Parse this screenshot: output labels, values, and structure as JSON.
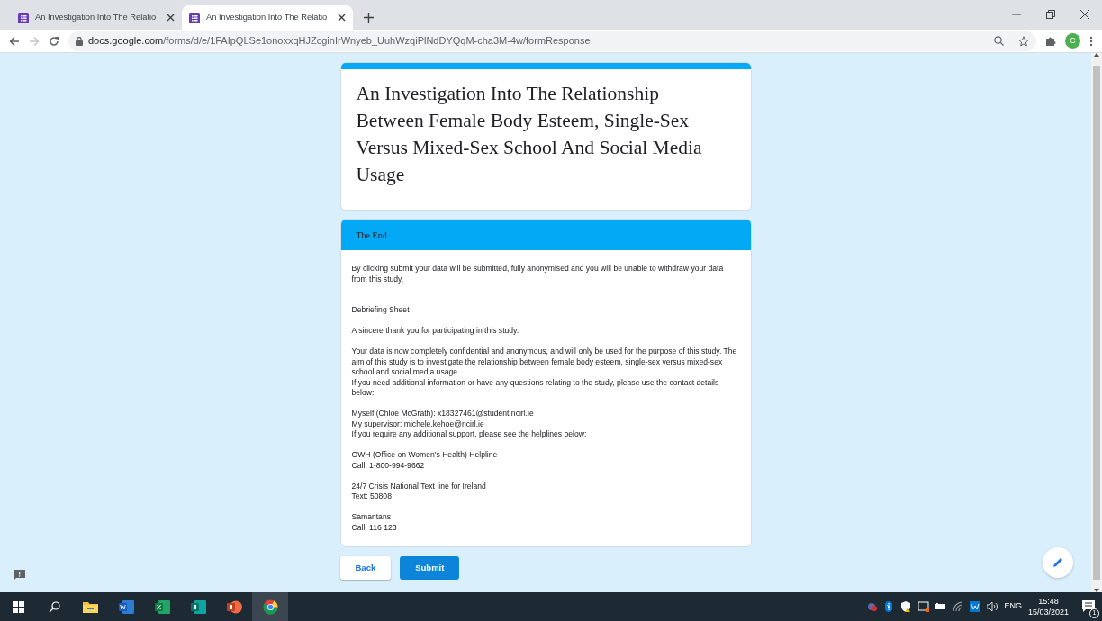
{
  "browser": {
    "tabs": [
      {
        "title": "An Investigation Into The Relatio",
        "selected": false
      },
      {
        "title": "An Investigation Into The Relatio",
        "selected": true
      }
    ],
    "url": {
      "domain": "docs.google.com",
      "path": "/forms/d/e/1FAIpQLSe1onoxxqHJZcginIrWnyeb_UuhWzqiPlNdDYQqM-cha3M-4w/formResponse"
    },
    "forward_disabled": true,
    "profile_initial": "C"
  },
  "form": {
    "title": "An Investigation Into The Relationship Between Female Body Esteem, Single-Sex Versus Mixed-Sex School And Social Media Usage",
    "section_title": "The End",
    "blocks": [
      {
        "lines": [
          {
            "text": "By clicking submit your data will be submitted, fully anonymised and you will be unable to withdraw your data from this study."
          }
        ]
      },
      {
        "lines": [
          {
            "text": "Debriefing Sheet"
          }
        ]
      },
      {
        "lines": [
          {
            "text": "A sincere thank you for participating in this study."
          }
        ]
      },
      {
        "lines": [
          {
            "text": "Your data is now completely confidential and anonymous, and will only be used for the purpose of this study. The aim of this study is to investigate the relationship between female body esteem, single-sex versus mixed-sex school and social media usage."
          },
          {
            "text": "If you need additional information or have any questions relating to the study, please use the contact details below:"
          }
        ]
      },
      {
        "lines": [
          {
            "text": "Myself (Chloe McGrath): ",
            "link": "x18327461@student.ncirl.ie"
          },
          {
            "text": "My supervisor: ",
            "link": "michele.kehoe@ncirl.ie"
          },
          {
            "text": "If you require any additional support, please see the helplines below:"
          }
        ]
      },
      {
        "lines": [
          {
            "text": "OWH (Office on Women's Health) Helpline"
          },
          {
            "text": "Call: 1-800-994-9662"
          }
        ]
      },
      {
        "lines": [
          {
            "text": "24/7 Crisis National Text line for Ireland"
          },
          {
            "text": "Text: 50808"
          }
        ]
      },
      {
        "lines": [
          {
            "text": "Samaritans"
          },
          {
            "text": "Call: 116 123"
          }
        ]
      }
    ],
    "buttons": [
      {
        "label": "Back",
        "kind": "secondary"
      },
      {
        "label": "Submit",
        "kind": "primary"
      }
    ]
  },
  "taskbar": {
    "apps": [
      {
        "kind": "explorer",
        "active": false
      },
      {
        "kind": "word",
        "active": false
      },
      {
        "kind": "excel",
        "active": false
      },
      {
        "kind": "publisher",
        "active": false
      },
      {
        "kind": "powerpoint",
        "active": false
      },
      {
        "kind": "chrome",
        "active": true
      }
    ],
    "language": "ENG",
    "time": "15:48",
    "date": "15/03/2021",
    "notifications": "1"
  }
}
